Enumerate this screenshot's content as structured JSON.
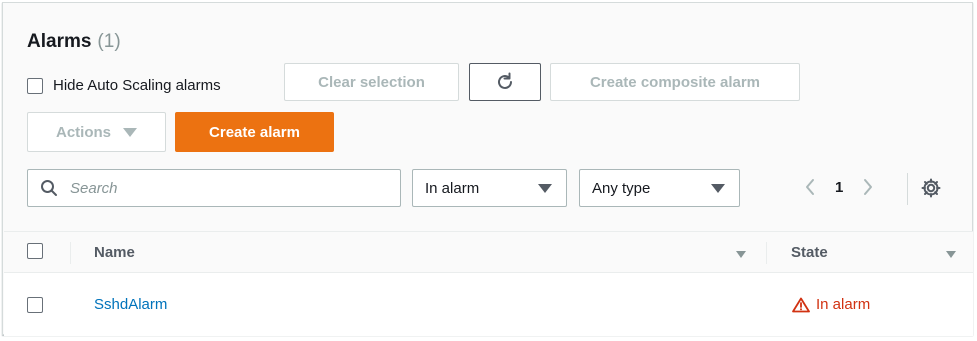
{
  "header": {
    "title": "Alarms",
    "count": "(1)"
  },
  "toolbar": {
    "hide_autoscaling_label": "Hide Auto Scaling alarms",
    "clear_selection_label": "Clear selection",
    "create_composite_label": "Create composite alarm",
    "actions_label": "Actions",
    "create_alarm_label": "Create alarm"
  },
  "filters": {
    "search_placeholder": "Search",
    "state_filter_value": "In alarm",
    "type_filter_value": "Any type"
  },
  "pagination": {
    "current_page": "1"
  },
  "table": {
    "columns": [
      "Name",
      "State"
    ],
    "rows": [
      {
        "name": "SshdAlarm",
        "state": "In alarm"
      }
    ]
  },
  "colors": {
    "primary": "#ec7211",
    "link": "#0073bb",
    "alarm": "#d13212"
  },
  "icons": [
    "refresh-icon",
    "search-icon",
    "chevron-left-icon",
    "chevron-right-icon",
    "gear-icon",
    "warning-icon",
    "caret-down-icon"
  ]
}
